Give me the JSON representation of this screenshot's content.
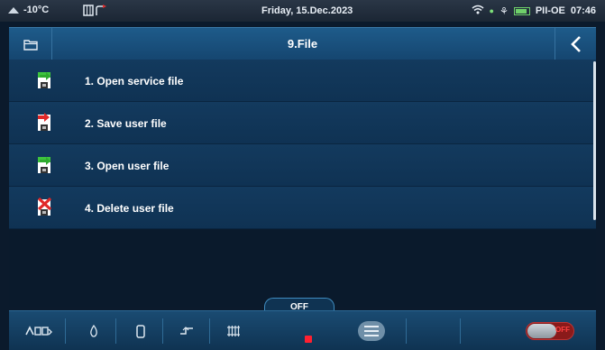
{
  "status_bar": {
    "temperature": "-10°C",
    "date": "Friday, 15.Dec.2023",
    "locale": "PII-OE",
    "time": "07:46"
  },
  "header": {
    "title": "9.File"
  },
  "menu": {
    "items": [
      {
        "label": "1. Open service file",
        "icon": "open-file-icon",
        "arrow_color": "#3ec43e"
      },
      {
        "label": "2. Save user file",
        "icon": "save-file-icon",
        "arrow_color": "#e02828"
      },
      {
        "label": "3. Open user file",
        "icon": "open-file-icon",
        "arrow_color": "#3ec43e"
      },
      {
        "label": "4. Delete user file",
        "icon": "delete-file-icon",
        "arrow_color": "#e02828"
      }
    ]
  },
  "bottom_bar": {
    "mode_label": "OFF",
    "power_toggle_label": "OFF"
  },
  "colors": {
    "header_blue": "#1e5b8a",
    "row_blue": "#133a5e",
    "stop_red": "#ff2030"
  }
}
